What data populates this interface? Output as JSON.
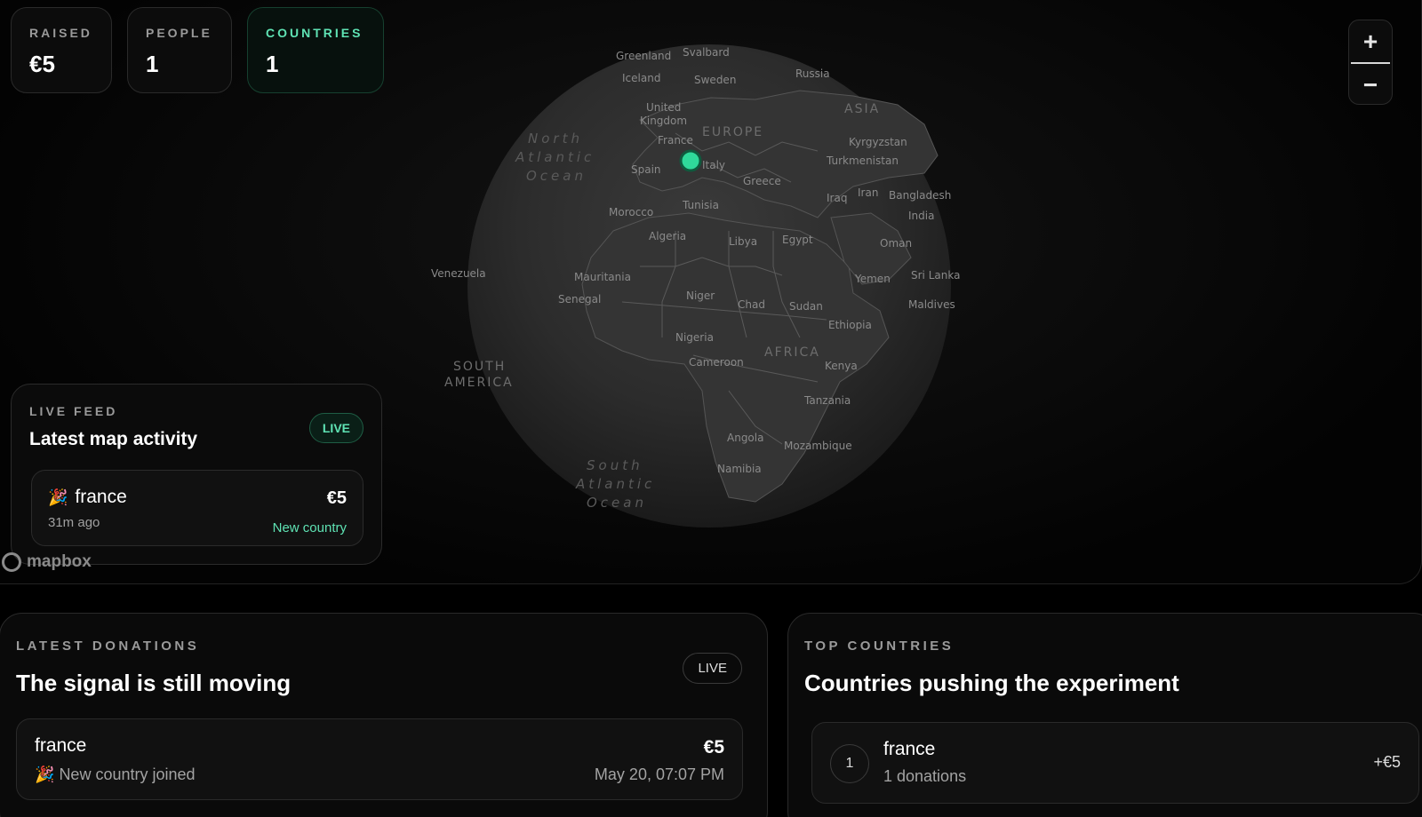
{
  "stats": {
    "raised": {
      "label": "RAISED",
      "value": "€5"
    },
    "people": {
      "label": "PEOPLE",
      "value": "1"
    },
    "countries": {
      "label": "COUNTRIES",
      "value": "1"
    }
  },
  "zoom": {
    "in": "+",
    "out": "−"
  },
  "map": {
    "labels": {
      "greenland": "Greenland",
      "svalbard": "Svalbard",
      "iceland": "Iceland",
      "sweden": "Sweden",
      "russia": "Russia",
      "uk1": "United",
      "uk2": "Kingdom",
      "asia": "ASIA",
      "france": "France",
      "europe": "EUROPE",
      "kyrgyzstan": "Kyrgyzstan",
      "turkmenistan": "Turkmenistan",
      "spain": "Spain",
      "italy": "Italy",
      "greece": "Greece",
      "iraq": "Iraq",
      "iran": "Iran",
      "bangladesh": "Bangladesh",
      "india": "India",
      "morocco": "Morocco",
      "tunisia": "Tunisia",
      "algeria": "Algeria",
      "libya": "Libya",
      "egypt": "Egypt",
      "oman": "Oman",
      "venezuela": "Venezuela",
      "mauritania": "Mauritania",
      "yemen": "Yemen",
      "srilanka": "Sri Lanka",
      "senegal": "Senegal",
      "niger": "Niger",
      "chad": "Chad",
      "sudan": "Sudan",
      "maldives": "Maldives",
      "ethiopia": "Ethiopia",
      "nigeria": "Nigeria",
      "africa": "AFRICA",
      "cameroon": "Cameroon",
      "kenya": "Kenya",
      "southamerica1": "SOUTH",
      "southamerica2": "AMERICA",
      "tanzania": "Tanzania",
      "angola": "Angola",
      "mozambique": "Mozambique",
      "namibia": "Namibia",
      "natlantic1": "North",
      "natlantic2": "Atlantic",
      "natlantic3": "Ocean",
      "satlantic1": "South",
      "satlantic2": "Atlantic",
      "satlantic3": "Ocean"
    },
    "attribution": "mapbox"
  },
  "live_feed": {
    "label": "LIVE FEED",
    "title": "Latest map activity",
    "badge": "LIVE",
    "item": {
      "emoji": "🎉",
      "country": "france",
      "time": "31m ago",
      "amount": "€5",
      "tag": "New country"
    }
  },
  "latest_donations": {
    "label": "LATEST DONATIONS",
    "title": "The signal is still moving",
    "badge": "LIVE",
    "row": {
      "country": "france",
      "emoji": "🎉",
      "note": "New country joined",
      "amount": "€5",
      "date": "May 20, 07:07 PM"
    }
  },
  "top_countries": {
    "label": "TOP COUNTRIES",
    "title": "Countries pushing the experiment",
    "row": {
      "rank": "1",
      "country": "france",
      "donations": "1 donations",
      "amount": "+€5"
    }
  },
  "colors": {
    "accent": "#5fe3b4",
    "marker": "#2fd99a"
  }
}
